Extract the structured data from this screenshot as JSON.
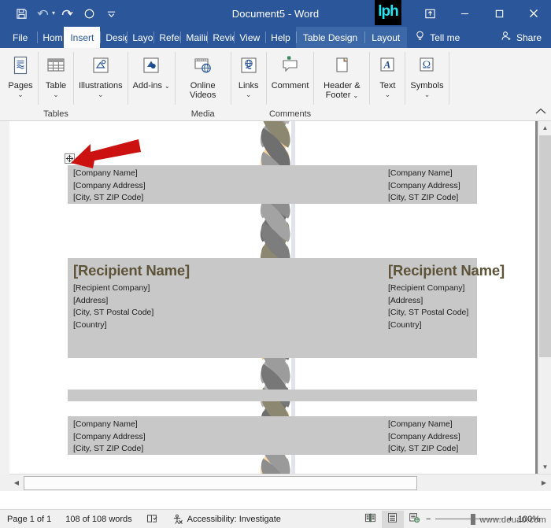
{
  "window": {
    "title": "Document5  -  Word",
    "quick_access": [
      {
        "name": "save",
        "icon": "save-icon"
      },
      {
        "name": "undo",
        "icon": "undo-icon"
      },
      {
        "name": "redo",
        "icon": "redo-icon"
      },
      {
        "name": "touch-mode",
        "icon": "circle-icon"
      },
      {
        "name": "customize-quick-access",
        "icon": "caret-down-icon"
      }
    ],
    "controls": [
      {
        "name": "ribbon-display-options",
        "icon": "ribbon-options-icon"
      },
      {
        "name": "minimize",
        "icon": "minimize-icon"
      },
      {
        "name": "maximize",
        "icon": "maximize-icon"
      },
      {
        "name": "close",
        "icon": "close-icon"
      }
    ],
    "watermark_logo": "lph"
  },
  "tabs": {
    "file": "File",
    "items": [
      {
        "label": "Home",
        "truncated": "Hom",
        "active": false,
        "contextual": false
      },
      {
        "label": "Insert",
        "truncated": "Insert",
        "active": true,
        "contextual": false
      },
      {
        "label": "Design",
        "truncated": "Desig",
        "active": false,
        "contextual": false
      },
      {
        "label": "Layout",
        "truncated": "Layou",
        "active": false,
        "contextual": false
      },
      {
        "label": "References",
        "truncated": "Refere",
        "active": false,
        "contextual": false
      },
      {
        "label": "Mailings",
        "truncated": "Mailin",
        "active": false,
        "contextual": false
      },
      {
        "label": "Review",
        "truncated": "Revie",
        "active": false,
        "contextual": false
      },
      {
        "label": "View",
        "truncated": "View",
        "active": false,
        "contextual": false
      },
      {
        "label": "Help",
        "truncated": "Help",
        "active": false,
        "contextual": false
      },
      {
        "label": "Table Design",
        "truncated": "Table Design",
        "active": false,
        "contextual": true
      },
      {
        "label": "Layout",
        "truncated": "Layout",
        "active": false,
        "contextual": true
      }
    ],
    "tell_me": "Tell me",
    "share": "Share"
  },
  "ribbon": {
    "groups": [
      {
        "name": "pages",
        "label": "",
        "buttons": [
          {
            "label": "Pages",
            "icon": "pages-icon",
            "caret": true
          }
        ]
      },
      {
        "name": "tables",
        "label": "Tables",
        "buttons": [
          {
            "label": "Table",
            "icon": "table-icon",
            "caret": true
          }
        ]
      },
      {
        "name": "illustrations",
        "label": "",
        "buttons": [
          {
            "label": "Illustrations",
            "icon": "illustrations-icon",
            "caret": true
          }
        ]
      },
      {
        "name": "addins",
        "label": "",
        "buttons": [
          {
            "label": "Add-ins",
            "icon": "addins-icon",
            "caret": true,
            "inline_caret": true
          }
        ]
      },
      {
        "name": "media",
        "label": "Media",
        "buttons": [
          {
            "label": "Online Videos",
            "icon": "online-video-icon",
            "caret": false
          }
        ]
      },
      {
        "name": "links",
        "label": "",
        "buttons": [
          {
            "label": "Links",
            "icon": "links-icon",
            "caret": true
          }
        ]
      },
      {
        "name": "comments",
        "label": "Comments",
        "buttons": [
          {
            "label": "Comment",
            "icon": "comment-icon",
            "caret": false
          }
        ]
      },
      {
        "name": "header-footer",
        "label": "",
        "buttons": [
          {
            "label": "Header & Footer",
            "icon": "header-footer-icon",
            "caret": true,
            "inline_caret": true
          }
        ]
      },
      {
        "name": "text",
        "label": "",
        "buttons": [
          {
            "label": "Text",
            "icon": "text-icon",
            "caret": true
          }
        ]
      },
      {
        "name": "symbols",
        "label": "",
        "buttons": [
          {
            "label": "Symbols",
            "icon": "symbols-icon",
            "caret": true
          }
        ]
      }
    ],
    "collapse_icon": "chevron-up-icon"
  },
  "document": {
    "blocks": [
      {
        "name": "sender-left-top",
        "lines": [
          "[Company Name]",
          "[Company Address]",
          "[City, ST  ZIP Code]"
        ]
      },
      {
        "name": "sender-right-top",
        "lines": [
          "[Company Name]",
          "[Company Address]",
          "[City, ST  ZIP Code]"
        ]
      },
      {
        "name": "recipient-left",
        "heading": "[Recipient Name]",
        "lines": [
          "[Recipient Company]",
          "[Address]",
          "[City, ST  Postal Code]",
          "[Country]"
        ]
      },
      {
        "name": "recipient-right",
        "heading": "[Recipient Name]",
        "lines": [
          "[Recipient Company]",
          "[Address]",
          "[City, ST  Postal Code]",
          "[Country]"
        ]
      },
      {
        "name": "sender-left-bottom",
        "lines": [
          "[Company Name]",
          "[Company Address]",
          "[City, ST  ZIP Code]"
        ]
      },
      {
        "name": "sender-right-bottom",
        "lines": [
          "[Company Name]",
          "[Company Address]",
          "[City, ST  ZIP Code]"
        ]
      }
    ],
    "table_move_handle": "table-move-handle",
    "annotation_arrow": "red-arrow-annotation",
    "colors": {
      "selection_shade": "#c8c8c8",
      "heading": "#5c5338",
      "stem": "#dfe5ea",
      "leaf_gray_light": "#a8a8a8",
      "leaf_gray_dark": "#7d7d7d",
      "leaf_olive": "#8b8770",
      "leaf_tan": "#e8c08d",
      "leaf_tan_light": "#f7d7a8",
      "arrow_red": "#cc1111",
      "accent_blue": "#2b579a"
    }
  },
  "statusbar": {
    "page": "Page 1 of 1",
    "words": "108 of 108 words",
    "proofing_icon": "proofing-errors-icon",
    "accessibility": "Accessibility: Investigate",
    "accessibility_icon": "accessibility-icon",
    "views": [
      {
        "name": "read-mode",
        "icon": "read-mode-icon",
        "active": false
      },
      {
        "name": "print-layout",
        "icon": "print-layout-icon",
        "active": true
      },
      {
        "name": "web-layout",
        "icon": "web-layout-icon",
        "active": false
      }
    ],
    "zoom_out": "−",
    "zoom_in": "+",
    "zoom_level": "100%",
    "watermark": "www.deua0.com"
  }
}
